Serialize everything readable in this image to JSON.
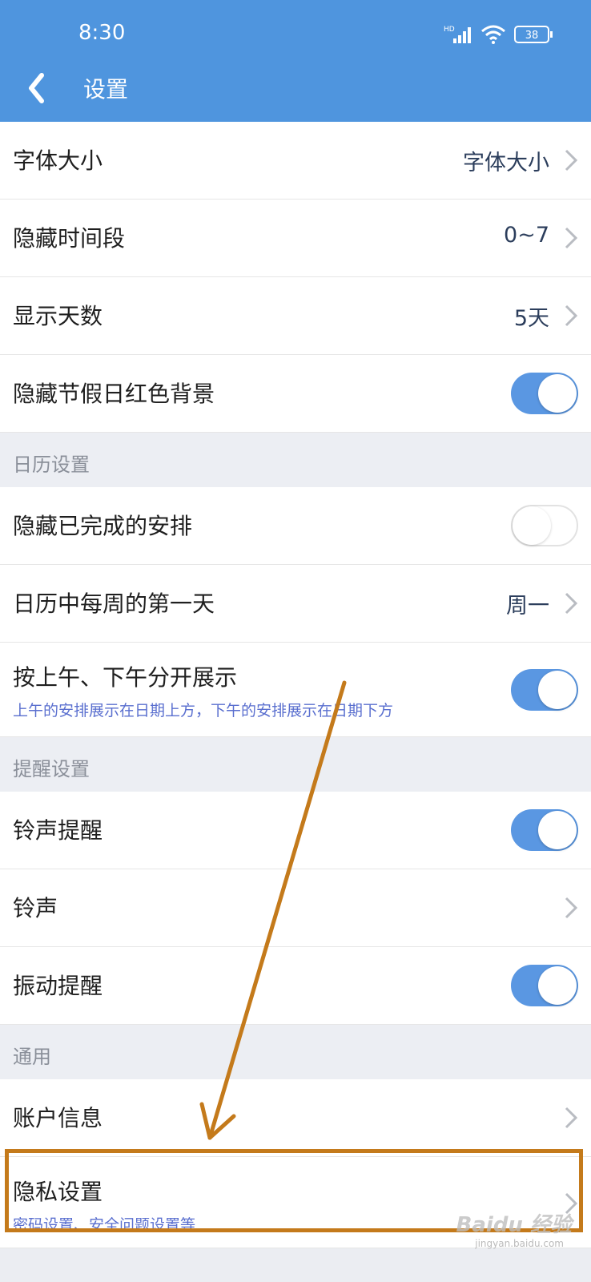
{
  "status_bar": {
    "time": "8:30",
    "network": "HD",
    "battery": "38"
  },
  "nav": {
    "title": "设置"
  },
  "rows_top": [
    {
      "label": "字体大小",
      "value": "字体大小",
      "kind": "chevron"
    },
    {
      "label": "隐藏时间段",
      "value": "0~7",
      "kind": "chevron"
    },
    {
      "label": "显示天数",
      "value": "5天",
      "kind": "chevron"
    },
    {
      "label": "隐藏节假日红色背景",
      "kind": "toggle",
      "on": true
    }
  ],
  "section_calendar": {
    "title": "日历设置",
    "rows": [
      {
        "label": "隐藏已完成的安排",
        "kind": "toggle",
        "on": false
      },
      {
        "label": "日历中每周的第一天",
        "value": "周一",
        "kind": "chevron"
      },
      {
        "label": "按上午、下午分开展示",
        "sub": "上午的安排展示在日期上方，下午的安排展示在日期下方",
        "kind": "toggle",
        "on": true
      }
    ]
  },
  "section_reminder": {
    "title": "提醒设置",
    "rows": [
      {
        "label": "铃声提醒",
        "kind": "toggle",
        "on": true
      },
      {
        "label": "铃声",
        "kind": "chevron"
      },
      {
        "label": "振动提醒",
        "kind": "toggle",
        "on": true
      }
    ]
  },
  "section_general": {
    "title": "通用",
    "rows": [
      {
        "label": "账户信息",
        "kind": "chevron"
      },
      {
        "label": "隐私设置",
        "sub": "密码设置、安全问题设置等",
        "kind": "chevron"
      }
    ]
  },
  "watermark": {
    "text": "Baidu 经验",
    "sub": "jingyan.baidu.com"
  },
  "colors": {
    "header": "#4f95de",
    "toggle_on": "#5a97e2",
    "highlight": "#c47a1b",
    "subtext": "#5a6fcf"
  }
}
